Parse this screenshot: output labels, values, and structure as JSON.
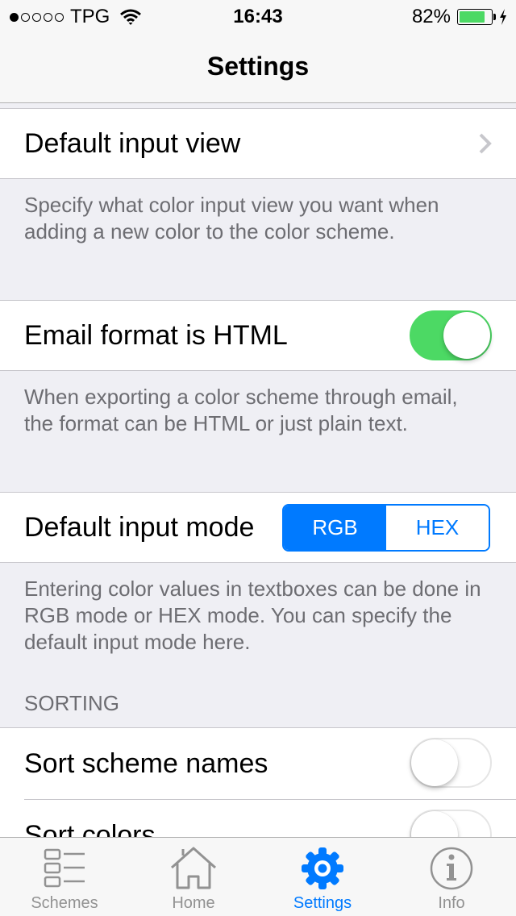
{
  "status_bar": {
    "signal_filled": 1,
    "signal_total": 5,
    "carrier": "TPG",
    "time": "16:43",
    "battery_percent_label": "82%",
    "battery_level": 0.82,
    "charging": true
  },
  "nav": {
    "title": "Settings"
  },
  "settings": {
    "default_input_view": {
      "label": "Default input view",
      "footer": "Specify what color input view you want when adding a new color to the color scheme."
    },
    "email_format": {
      "label": "Email format is HTML",
      "on": true,
      "footer": "When exporting a color scheme through email, the format can be HTML or just plain text."
    },
    "default_input_mode": {
      "label": "Default input mode",
      "options": [
        "RGB",
        "HEX"
      ],
      "selected": "RGB",
      "footer": "Entering color values in textboxes can be done in RGB mode or HEX mode. You can specify the default input mode here."
    }
  },
  "sorting": {
    "header": "SORTING",
    "sort_scheme_names": {
      "label": "Sort scheme names",
      "on": false
    },
    "sort_colors": {
      "label": "Sort colors",
      "on": false
    }
  },
  "tab_bar": {
    "tabs": [
      {
        "label": "Schemes",
        "icon": "list-icon",
        "active": false
      },
      {
        "label": "Home",
        "icon": "home-icon",
        "active": false
      },
      {
        "label": "Settings",
        "icon": "gear-icon",
        "active": true
      },
      {
        "label": "Info",
        "icon": "info-icon",
        "active": false
      }
    ]
  },
  "colors": {
    "accent": "#007aff",
    "toggle_on": "#4cd964",
    "battery": "#4cd964",
    "background": "#efeff4"
  }
}
